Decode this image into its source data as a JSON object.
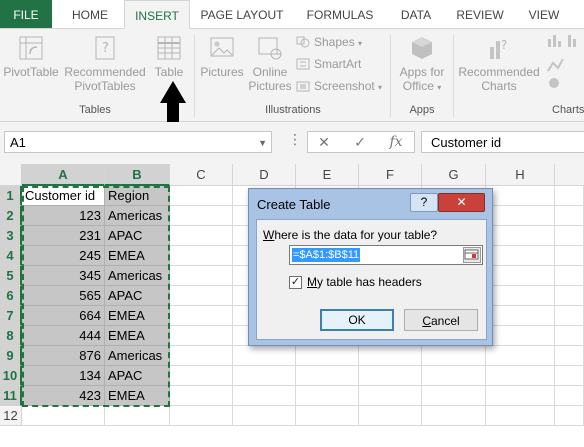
{
  "tabs": [
    "FILE",
    "HOME",
    "INSERT",
    "PAGE LAYOUT",
    "FORMULAS",
    "DATA",
    "REVIEW",
    "VIEW"
  ],
  "active_tab": "INSERT",
  "ribbon": {
    "tables": {
      "pivottable": "PivotTable",
      "recommended_pivot_1": "Recommended",
      "recommended_pivot_2": "PivotTables",
      "table": "Table",
      "group": "Tables"
    },
    "illustrations": {
      "pictures": "Pictures",
      "online_1": "Online",
      "online_2": "Pictures",
      "shapes": "Shapes",
      "smartart": "SmartArt",
      "screenshot": "Screenshot",
      "group": "Illustrations"
    },
    "apps": {
      "apps_1": "Apps for",
      "apps_2": "Office",
      "group": "Apps"
    },
    "charts": {
      "rec_1": "Recommended",
      "rec_2": "Charts",
      "group": "Charts"
    }
  },
  "formula_bar": {
    "name_box": "A1",
    "cancel": "✕",
    "enter": "✓",
    "fx": "fx",
    "formula": "Customer id"
  },
  "columns": [
    "A",
    "B",
    "C",
    "D",
    "E",
    "F",
    "G",
    "H"
  ],
  "rows": [
    "1",
    "2",
    "3",
    "4",
    "5",
    "6",
    "7",
    "8",
    "9",
    "10",
    "11",
    "12"
  ],
  "table": {
    "headers": [
      "Customer id",
      "Region"
    ],
    "data": [
      [
        "123",
        "Americas"
      ],
      [
        "231",
        "APAC"
      ],
      [
        "245",
        "EMEA"
      ],
      [
        "345",
        "Americas"
      ],
      [
        "565",
        "APAC"
      ],
      [
        "664",
        "EMEA"
      ],
      [
        "444",
        "EMEA"
      ],
      [
        "876",
        "Americas"
      ],
      [
        "134",
        "APAC"
      ],
      [
        "423",
        "EMEA"
      ]
    ]
  },
  "dialog": {
    "title": "Create Table",
    "help": "?",
    "close": "✕",
    "question": "Where is the data for your table?",
    "question_accel": "W",
    "question_rest": "here is the data for your table?",
    "range": "=$A$1:$B$11",
    "checkbox_checked": true,
    "checkbox_accel": "M",
    "checkbox_rest": "y table has headers",
    "ok": "OK",
    "cancel_accel": "C",
    "cancel_rest": "ancel"
  },
  "colors": {
    "excel_green": "#217346",
    "selection": "#c6c6c6",
    "dialog_frame": "#a9c3e4"
  }
}
